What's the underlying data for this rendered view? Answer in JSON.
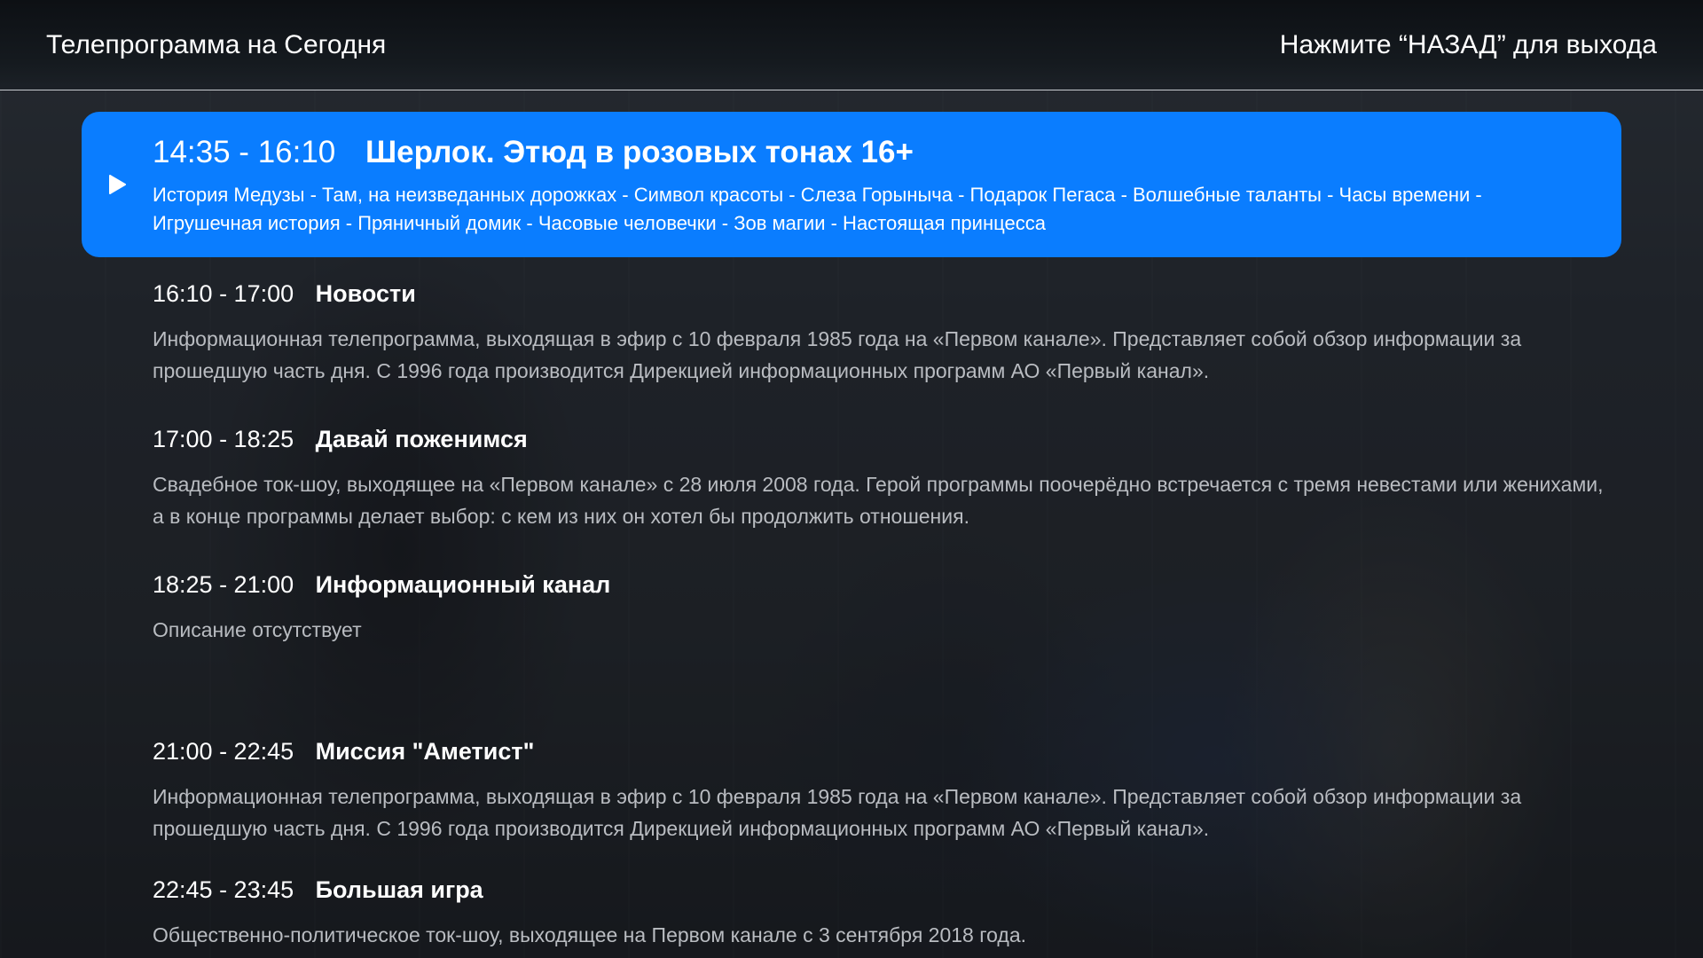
{
  "header": {
    "title": "Телепрограмма на Сегодня",
    "hint": "Нажмите “НАЗАД” для выхода"
  },
  "current": {
    "time": "14:35 - 16:10",
    "title": "Шерлок. Этюд в розовых тонах 16+",
    "description": "История Медузы - Там, на неизведанных дорожках - Символ красоты - Слеза Горыныча - Подарок Пегаса -  Волшебные таланты - Часы времени - Игрушечная история - Пряничный домик - Часовые человечки - Зов магии - Настоящая принцесса",
    "icon": "play-icon"
  },
  "programs": [
    {
      "time": "16:10 - 17:00",
      "title": "Новости",
      "description": "Информационная телепрограмма, выходящая в эфир с 10 февраля 1985 года на «Первом канале». Представляет собой обзор информации за прошедшую часть дня. С 1996 года производится Дирекцией информационных программ АО «Первый канал»."
    },
    {
      "time": "17:00 - 18:25",
      "title": "Давай поженимся",
      "description": "Свадебное ток-шоу, выходящее на «Первом канале» с 28 июля 2008 года. Герой программы поочерёдно встречается с тремя невестами или женихами, а в конце программы делает выбор: с кем из них он хотел бы продолжить отношения."
    },
    {
      "time": "18:25 - 21:00",
      "title": "Информационный канал",
      "description": "Описание отсутствует"
    },
    {
      "time": "21:00 - 22:45",
      "title": "Миссия \"Аметист\"",
      "description": "Информационная телепрограмма, выходящая в эфир с 10 февраля 1985 года на «Первом канале». Представляет собой обзор информации за прошедшую часть дня. С 1996 года производится Дирекцией информационных программ АО «Первый канал»."
    },
    {
      "time": "22:45 - 23:45",
      "title": "Большая игра",
      "description": "Общественно-политическое ток-шоу, выходящее на Первом канале с 3 сентября 2018 года."
    }
  ],
  "colors": {
    "accent": "#0a7dff",
    "text": "#ffffff",
    "muted_text": "#b9bcc1",
    "header_bg": "#0d1014"
  }
}
